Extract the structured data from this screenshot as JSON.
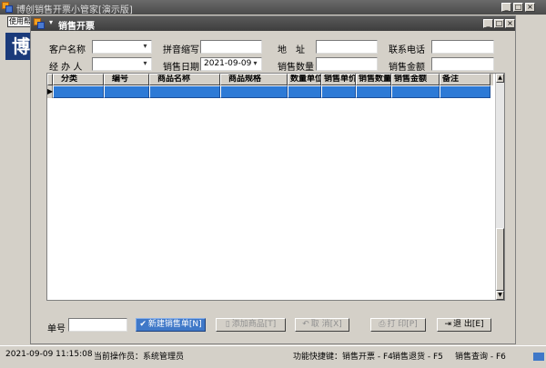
{
  "outer_window": {
    "title": "博创销售开票小管家[演示版]",
    "help_button": "使用帮",
    "bg_logo": "博"
  },
  "dialog": {
    "title": "销售开票"
  },
  "form": {
    "customer_label": "客户名称",
    "customer_value": "",
    "pinyin_label": "拼音缩写",
    "pinyin_value": "",
    "address_label": "地　址",
    "address_value": "",
    "phone_label": "联系电话",
    "phone_value": "",
    "handler_label": "经 办 人",
    "handler_value": "",
    "date_label": "销售日期",
    "date_value": "2021-09-09",
    "qty_label": "销售数量",
    "qty_value": "",
    "amount_label": "销售金额",
    "amount_value": "",
    "order_label": "单号",
    "order_value": ""
  },
  "grid": {
    "columns": [
      "分类",
      "编号",
      "商品名称",
      "商品规格",
      "数量单位",
      "销售单价",
      "销售数量",
      "销售金额",
      "备注"
    ],
    "row_indicator": "▶"
  },
  "buttons": {
    "new": "新建销售单[N]",
    "add": "添加商品[T]",
    "cancel": "取 消[X]",
    "print": "打 印[P]",
    "exit": "退 出[E]"
  },
  "status_bar": {
    "datetime": "2021-09-09  11:15:08",
    "operator": "当前操作员：系统管理员",
    "shortcut": "功能快捷键：销售开票 - F4",
    "return": "销售退货 - F5",
    "query": "销售查询 - F6"
  },
  "colors": {
    "accent": "#2d7ad6",
    "title_bar": "#4a4a4a"
  },
  "icons": {
    "app": "app-logo-icon",
    "dropdown": "calendar-dropdown-icon"
  }
}
